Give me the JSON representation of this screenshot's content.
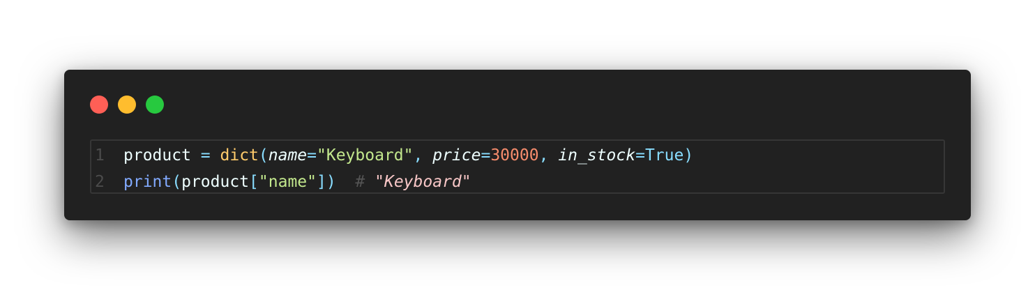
{
  "window": {
    "traffic_lights": [
      {
        "name": "close",
        "color": "#ff5f56"
      },
      {
        "name": "minimize",
        "color": "#ffbd2e"
      },
      {
        "name": "maximize",
        "color": "#27c93f"
      }
    ]
  },
  "code": {
    "lines": [
      {
        "number": "1",
        "tokens": [
          {
            "text": "product",
            "kind": "id"
          },
          {
            "text": " ",
            "kind": "id"
          },
          {
            "text": "=",
            "kind": "op"
          },
          {
            "text": " ",
            "kind": "id"
          },
          {
            "text": "dict",
            "kind": "fn"
          },
          {
            "text": "(",
            "kind": "op"
          },
          {
            "text": "name",
            "kind": "param"
          },
          {
            "text": "=",
            "kind": "op"
          },
          {
            "text": "\"Keyboard\"",
            "kind": "str"
          },
          {
            "text": ",",
            "kind": "op"
          },
          {
            "text": " ",
            "kind": "id"
          },
          {
            "text": "price",
            "kind": "param"
          },
          {
            "text": "=",
            "kind": "op"
          },
          {
            "text": "30000",
            "kind": "num"
          },
          {
            "text": ",",
            "kind": "op"
          },
          {
            "text": " ",
            "kind": "id"
          },
          {
            "text": "in_stock",
            "kind": "param"
          },
          {
            "text": "=",
            "kind": "op"
          },
          {
            "text": "True",
            "kind": "const"
          },
          {
            "text": ")",
            "kind": "op"
          }
        ]
      },
      {
        "number": "2",
        "tokens": [
          {
            "text": "print",
            "kind": "builtin"
          },
          {
            "text": "(",
            "kind": "op"
          },
          {
            "text": "product",
            "kind": "id"
          },
          {
            "text": "[",
            "kind": "op"
          },
          {
            "text": "\"name\"",
            "kind": "str"
          },
          {
            "text": "]",
            "kind": "op"
          },
          {
            "text": ")",
            "kind": "op"
          },
          {
            "text": "  ",
            "kind": "id"
          },
          {
            "text": "#",
            "kind": "comment"
          },
          {
            "text": " ",
            "kind": "id"
          },
          {
            "text": "\"Keyboard\"",
            "kind": "comment-str"
          }
        ]
      }
    ]
  }
}
